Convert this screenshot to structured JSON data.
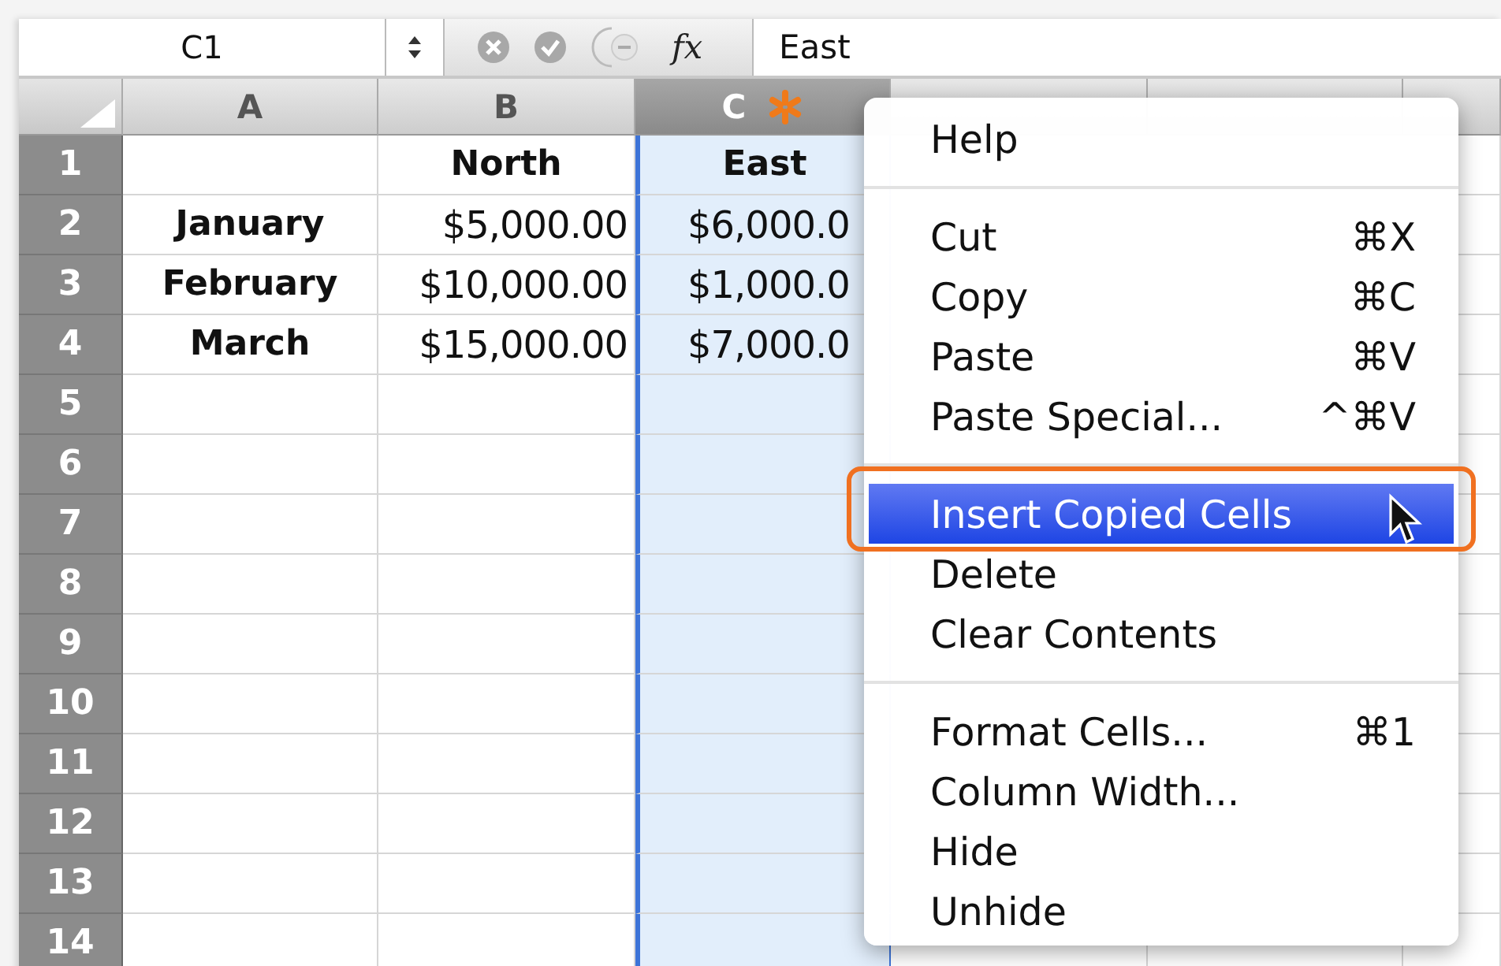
{
  "formula_bar": {
    "name_box": "C1",
    "function_label": "fx",
    "value": "East"
  },
  "columns": [
    {
      "label": "A",
      "selected": false
    },
    {
      "label": "B",
      "selected": false
    },
    {
      "label": "C",
      "selected": true,
      "flagged": true
    },
    {
      "selected": false
    },
    {
      "selected": false
    },
    {
      "selected": false
    }
  ],
  "rows": [
    {
      "header": "1",
      "cells": [
        null,
        "North",
        "East",
        null,
        null,
        null
      ]
    },
    {
      "header": "2",
      "cells": [
        "January",
        "$5,000.00",
        "$6,000.0",
        null,
        null,
        null
      ]
    },
    {
      "header": "3",
      "cells": [
        "February",
        "$10,000.00",
        "$1,000.0",
        null,
        null,
        null
      ]
    },
    {
      "header": "4",
      "cells": [
        "March",
        "$15,000.00",
        "$7,000.0",
        null,
        null,
        null
      ]
    },
    {
      "header": "5",
      "cells": [
        null,
        null,
        null,
        null,
        null,
        null
      ]
    },
    {
      "header": "6",
      "cells": [
        null,
        null,
        null,
        null,
        null,
        null
      ]
    },
    {
      "header": "7",
      "cells": [
        null,
        null,
        null,
        null,
        null,
        null
      ]
    },
    {
      "header": "8",
      "cells": [
        null,
        null,
        null,
        null,
        null,
        null
      ]
    },
    {
      "header": "9",
      "cells": [
        null,
        null,
        null,
        null,
        null,
        null
      ]
    },
    {
      "header": "10",
      "cells": [
        null,
        null,
        null,
        null,
        null,
        null
      ]
    },
    {
      "header": "11",
      "cells": [
        null,
        null,
        null,
        null,
        null,
        null
      ]
    },
    {
      "header": "12",
      "cells": [
        null,
        null,
        null,
        null,
        null,
        null
      ]
    },
    {
      "header": "13",
      "cells": [
        null,
        null,
        null,
        null,
        null,
        null
      ]
    },
    {
      "header": "14",
      "cells": [
        null,
        null,
        null,
        null,
        null,
        null
      ]
    }
  ],
  "context_menu": [
    {
      "kind": "item",
      "label": "Help",
      "selected": false
    },
    {
      "kind": "separator"
    },
    {
      "kind": "item",
      "label": "Cut",
      "shortcut": "⌘X",
      "selected": false
    },
    {
      "kind": "item",
      "label": "Copy",
      "shortcut": "⌘C",
      "selected": false
    },
    {
      "kind": "item",
      "label": "Paste",
      "shortcut": "⌘V",
      "selected": false
    },
    {
      "kind": "item",
      "label": "Paste Special...",
      "shortcut": "^⌘V",
      "selected": false
    },
    {
      "kind": "separator"
    },
    {
      "kind": "item",
      "label": "Insert Copied Cells",
      "selected": true
    },
    {
      "kind": "item",
      "label": "Delete",
      "selected": false
    },
    {
      "kind": "item",
      "label": "Clear Contents",
      "selected": false
    },
    {
      "kind": "separator"
    },
    {
      "kind": "item",
      "label": "Format Cells...",
      "shortcut": "⌘1",
      "selected": false
    },
    {
      "kind": "item",
      "label": "Column Width...",
      "selected": false
    },
    {
      "kind": "item",
      "label": "Hide",
      "selected": false
    },
    {
      "kind": "item",
      "label": "Unhide",
      "selected": false
    }
  ]
}
